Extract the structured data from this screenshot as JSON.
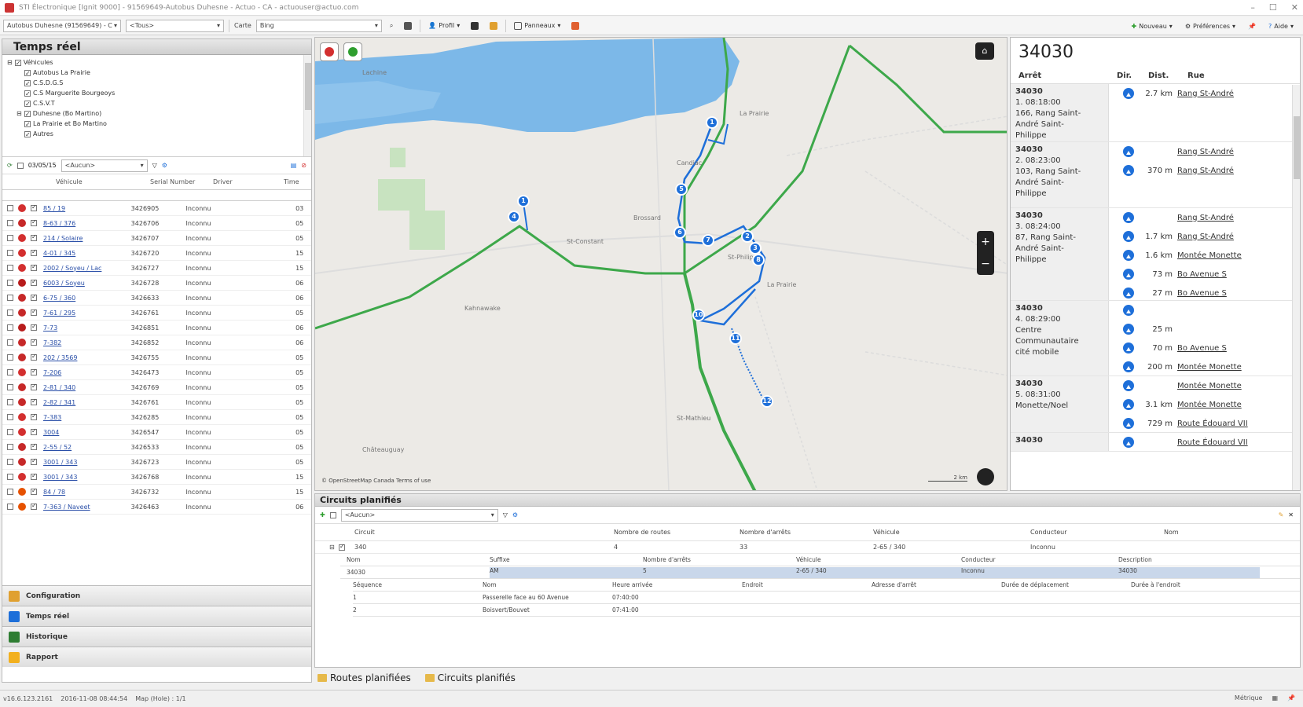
{
  "window": {
    "title": "STI Électronique [Ignit 9000] - 91569649-Autobus Duhesne - Actuo - CA - actuouser@actuo.com",
    "buttons": [
      "–",
      "☐",
      "✕"
    ]
  },
  "toolbar": {
    "account_combo": "Autobus Duhesne (91569649) - C",
    "tous_combo": "<Tous>",
    "carte_label": "Carte",
    "search_value": "Bing",
    "profil": "Profil",
    "panneaux": "Panneaux",
    "nouveau": "Nouveau",
    "preferences": "Préférences",
    "aide": "Aide"
  },
  "left_panel": {
    "title": "Temps réel",
    "tree": [
      "Véhicules",
      "Autobus La Prairie",
      "C.S.D.G.S",
      "C.S Marguerite Bourgeoys",
      "C.S.V.T",
      "Duhesne (Bo Martino)",
      "La Prairie et Bo Martino",
      "Autres"
    ],
    "filter": {
      "date": "03/05/15",
      "combo": "<Aucun>"
    },
    "columns": {
      "vehicle": "Véhicule",
      "serial": "Serial Number",
      "driver": "Driver",
      "time": "Time"
    },
    "rows": [
      {
        "name": "85 / 19",
        "serial": "3426905",
        "driver": "Inconnu",
        "time": "03",
        "status": "#d32f2f"
      },
      {
        "name": "8-63 / 376",
        "serial": "3426706",
        "driver": "Inconnu",
        "time": "05",
        "status": "#c62828"
      },
      {
        "name": "214 / Solaire",
        "serial": "3426707",
        "driver": "Inconnu",
        "time": "05",
        "status": "#d32f2f"
      },
      {
        "name": "4-01 / 345",
        "serial": "3426720",
        "driver": "Inconnu",
        "time": "15",
        "status": "#d32f2f"
      },
      {
        "name": "2002 / Soyeu / Lac",
        "serial": "3426727",
        "driver": "Inconnu",
        "time": "15",
        "status": "#d32f2f"
      },
      {
        "name": "6003 / Soyeu",
        "serial": "3426728",
        "driver": "Inconnu",
        "time": "06",
        "status": "#b71c1c"
      },
      {
        "name": "6-75 / 360",
        "serial": "3426633",
        "driver": "Inconnu",
        "time": "06",
        "status": "#c62828"
      },
      {
        "name": "7-61 / 295",
        "serial": "3426761",
        "driver": "Inconnu",
        "time": "05",
        "status": "#c62828"
      },
      {
        "name": "7-73",
        "serial": "3426851",
        "driver": "Inconnu",
        "time": "06",
        "status": "#b71c1c"
      },
      {
        "name": "7-382",
        "serial": "3426852",
        "driver": "Inconnu",
        "time": "06",
        "status": "#c62828"
      },
      {
        "name": "202 / 3569",
        "serial": "3426755",
        "driver": "Inconnu",
        "time": "05",
        "status": "#c62828"
      },
      {
        "name": "7-206",
        "serial": "3426473",
        "driver": "Inconnu",
        "time": "05",
        "status": "#d32f2f"
      },
      {
        "name": "2-81 / 340",
        "serial": "3426769",
        "driver": "Inconnu",
        "time": "05",
        "status": "#c62828"
      },
      {
        "name": "2-82 / 341",
        "serial": "3426761",
        "driver": "Inconnu",
        "time": "05",
        "status": "#c62828"
      },
      {
        "name": "7-383",
        "serial": "3426285",
        "driver": "Inconnu",
        "time": "05",
        "status": "#d32f2f"
      },
      {
        "name": "3004",
        "serial": "3426547",
        "driver": "Inconnu",
        "time": "05",
        "status": "#d32f2f"
      },
      {
        "name": "2-55 / 52",
        "serial": "3426533",
        "driver": "Inconnu",
        "time": "05",
        "status": "#c62828"
      },
      {
        "name": "3001 / 343",
        "serial": "3426723",
        "driver": "Inconnu",
        "time": "05",
        "status": "#c62828"
      },
      {
        "name": "3001 / 343",
        "serial": "3426768",
        "driver": "Inconnu",
        "time": "15",
        "status": "#d32f2f"
      },
      {
        "name": "84 / 78",
        "serial": "3426732",
        "driver": "Inconnu",
        "time": "15",
        "status": "#e65100"
      },
      {
        "name": "7-363 / Naveet",
        "serial": "3426463",
        "driver": "Inconnu",
        "time": "06",
        "status": "#e65100"
      }
    ],
    "nav": {
      "configuration": "Configuration",
      "temps_reel": "Temps réel",
      "historique": "Historique",
      "rapport": "Rapport"
    }
  },
  "map": {
    "labels": {
      "lachine": "Lachine",
      "la_prairie": "La Prairie",
      "candiac": "Candiac",
      "brossard": "Brossard",
      "st_constant": "St-Constant",
      "st_philippe": "St-Philippe",
      "la_prairie2": "La Prairie",
      "st_mathieu": "St-Mathieu",
      "kahnawake": "Kahnawake",
      "chateauguay": "Châteauguay"
    },
    "attribution": "© OpenStreetMap  Canada  Terms of use",
    "scale": "2 km",
    "zoom_in": "+",
    "zoom_out": "−"
  },
  "right_panel": {
    "title": "34030",
    "headers": {
      "stop": "Arrêt",
      "dir": "Dir.",
      "dist": "Dist.",
      "street": "Rue"
    },
    "stops": [
      {
        "id": "34030",
        "lines": [
          "1. 08:18:00",
          "166, Rang Saint-",
          "André Saint-",
          "Philippe"
        ]
      },
      {
        "id": "34030",
        "lines": [
          "2. 08:23:00",
          "103, Rang Saint-",
          "André Saint-",
          "Philippe"
        ]
      },
      {
        "id": "34030",
        "lines": [
          "3. 08:24:00",
          "87, Rang Saint-",
          "André Saint-",
          "Philippe"
        ]
      },
      {
        "id": "34030",
        "lines": [
          "4. 08:29:00",
          "Centre",
          "Communautaire",
          "cité mobile"
        ]
      },
      {
        "id": "34030",
        "lines": [
          "5. 08:31:00",
          "Monette/Noel"
        ]
      },
      {
        "id": "34030",
        "lines": []
      }
    ],
    "directions": [
      [
        {
          "dist": "2.7 km",
          "street": "Rang St-André"
        }
      ],
      [
        {
          "dist": "",
          "street": "Rang St-André"
        },
        {
          "dist": "370 m",
          "street": "Rang St-André"
        }
      ],
      [
        {
          "dist": "",
          "street": "Rang St-André"
        },
        {
          "dist": "1.7 km",
          "street": "Rang St-André"
        },
        {
          "dist": "1.6 km",
          "street": "Montée Monette"
        },
        {
          "dist": "73 m",
          "street": "Bo Avenue S"
        },
        {
          "dist": "27 m",
          "street": "Bo Avenue S"
        }
      ],
      [
        {
          "dist": "",
          "street": ""
        },
        {
          "dist": "25 m",
          "street": ""
        },
        {
          "dist": "70 m",
          "street": "Bo Avenue S"
        },
        {
          "dist": "200 m",
          "street": "Montée Monette"
        }
      ],
      [
        {
          "dist": "",
          "street": "Montée Monette"
        },
        {
          "dist": "3.1 km",
          "street": "Montée Monette"
        },
        {
          "dist": "729 m",
          "street": "Route Édouard VII"
        }
      ],
      [
        {
          "dist": "",
          "street": "Route Édouard VII"
        }
      ]
    ]
  },
  "bottom_panel": {
    "title": "Circuits planifiés",
    "combo": "<Aucun>",
    "columns": [
      "Circuit",
      "Nombre de routes",
      "Nombre d'arrêts",
      "Véhicule",
      "Conducteur",
      "Nom"
    ],
    "row": {
      "circuit": "340",
      "routes": "4",
      "stops": "33",
      "vehicle": "2-65 / 340",
      "driver": "Inconnu",
      "name": ""
    },
    "sub_columns": [
      "Nom",
      "Suffixe",
      "Nombre d'arrêts",
      "Véhicule",
      "Conducteur",
      "Description"
    ],
    "sub_row": {
      "name": "34030",
      "suffix": "AM",
      "stops": "5",
      "vehicle": "2-65 / 340",
      "driver": "Inconnu",
      "description": "34030"
    },
    "stop_columns": [
      "Séquence",
      "Nom",
      "Heure arrivée",
      "Endroit",
      "Adresse d'arrêt",
      "Durée de déplacement",
      "Durée à l'endroit"
    ],
    "stop_rows": [
      {
        "seq": "1",
        "name": "Passerelle face au 60 Avenue",
        "time": "07:40:00"
      },
      {
        "seq": "2",
        "name": "Boisvert/Bouvet",
        "time": "07:41:00"
      }
    ],
    "tabs": [
      "Routes planifiées",
      "Circuits planifiés"
    ]
  },
  "statusbar": {
    "version": "v16.6.123.2161",
    "timestamp": "2016-11-08 08:44:54",
    "map": "Map (Hole) : 1/1",
    "metric": "Métrique"
  }
}
